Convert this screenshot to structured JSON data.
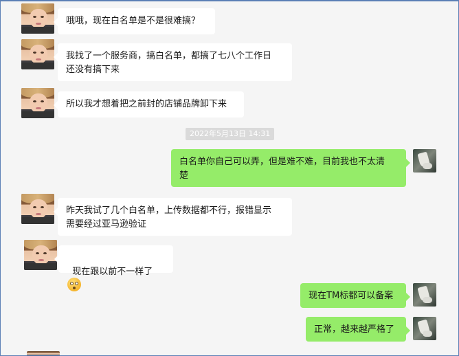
{
  "timestamp": "2022年5月13日 14:31",
  "messages": [
    {
      "side": "left",
      "text": "哦哦，现在白名单是不是很难搞？"
    },
    {
      "side": "left",
      "text": "我找了一个服务商，搞白名单，都搞了七八个工作日\n还没有搞下来"
    },
    {
      "side": "left",
      "text": "所以我才想着把之前封的店铺品牌卸下来"
    },
    {
      "side": "right",
      "text": "白名单你自己可以弄，但是难不难，目前我也不太清\n楚"
    },
    {
      "side": "left",
      "text": "昨天我试了几个白名单，上传数据都不行，报错显示\n需要经过亚马逊验证"
    },
    {
      "side": "left",
      "text": "现在跟以前不一样了",
      "emoji": "flushed-face-icon"
    },
    {
      "side": "right",
      "text": "现在TM标都可以备案"
    },
    {
      "side": "right",
      "text": "正常，越来越严格了"
    }
  ],
  "colors": {
    "incoming_bubble": "#ffffff",
    "outgoing_bubble": "#95ec69",
    "background": "#f5f5f5"
  }
}
